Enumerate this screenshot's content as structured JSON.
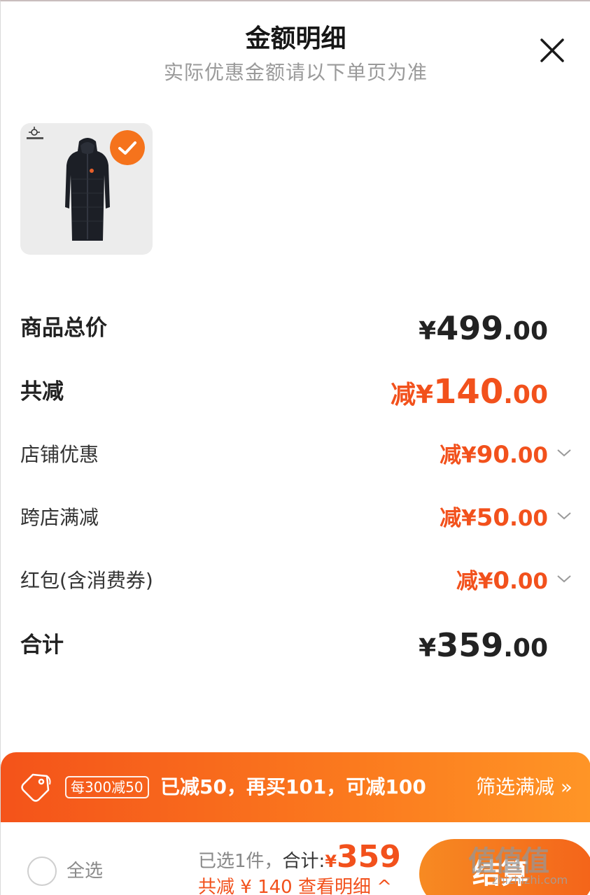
{
  "header": {
    "title": "金额明细",
    "subtitle": "实际优惠金额请以下单页为准"
  },
  "product": {
    "icon": "down-coat-image",
    "selected": true
  },
  "details": {
    "total_label": "商品总价",
    "total_cur": "¥",
    "total_int": "499",
    "total_dec": ".00",
    "discount_label": "共减",
    "discount_cur": "减¥",
    "discount_int": "140",
    "discount_dec": ".00",
    "shop_label": "店铺优惠",
    "shop_cur": "减¥",
    "shop_int": "90",
    "shop_dec": ".00",
    "cross_label": "跨店满减",
    "cross_cur": "减¥",
    "cross_int": "50",
    "cross_dec": ".00",
    "redpacket_label": "红包(含消费券)",
    "redpacket_cur": "减¥",
    "redpacket_int": "0",
    "redpacket_dec": ".00",
    "sum_label": "合计",
    "sum_cur": "¥",
    "sum_int": "359",
    "sum_dec": ".00"
  },
  "promo": {
    "rule": "每300减50",
    "message": "已减50，再买101，可减100",
    "filter": "筛选满减 »"
  },
  "bottom": {
    "select_all": "全选",
    "selected_count": "已选1件，",
    "total_label": "合计:",
    "total_currency": "¥",
    "total_value": "359",
    "saved_text": "共减 ¥ 140",
    "view_detail": "查看明细 ^",
    "checkout": "结算"
  },
  "watermark": {
    "logo": "值值值",
    "url": "zhizhizhi.com"
  },
  "colors": {
    "accent": "#f2511c",
    "banner_start": "#f4531a",
    "banner_end": "#ff9526"
  }
}
